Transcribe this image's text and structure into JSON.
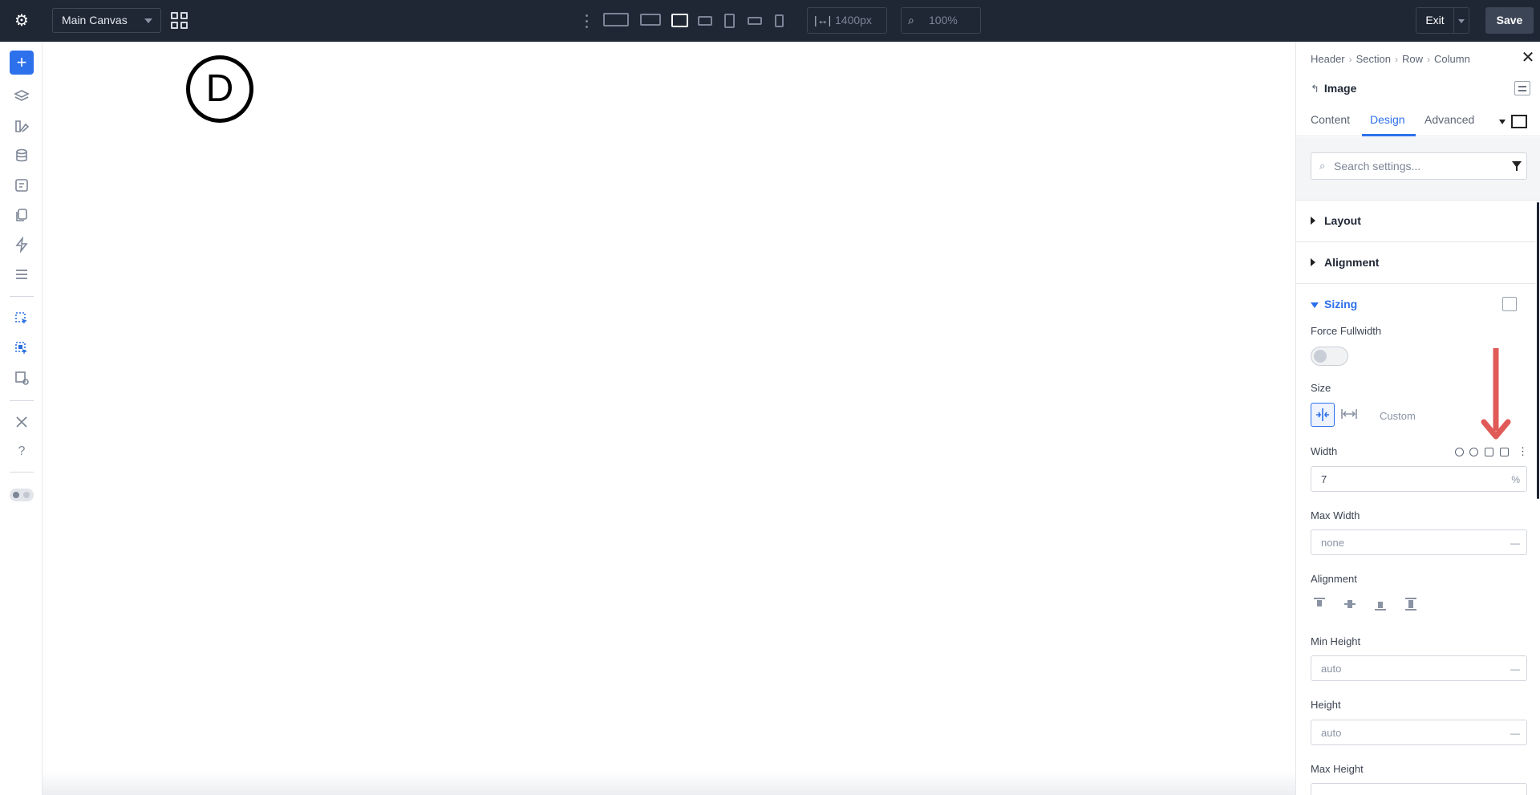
{
  "topbar": {
    "canvas_select": "Main Canvas",
    "width_value": "1400px",
    "zoom_value": "100%",
    "exit_label": "Exit",
    "save_label": "Save"
  },
  "canvas": {
    "logo_letter": "D"
  },
  "panel": {
    "breadcrumb": [
      "Header",
      "Section",
      "Row",
      "Column"
    ],
    "module_title": "Image",
    "tabs": [
      "Content",
      "Design",
      "Advanced"
    ],
    "active_tab": "Design",
    "search_placeholder": "Search settings...",
    "groups": {
      "layout": "Layout",
      "alignment": "Alignment",
      "sizing": "Sizing"
    },
    "sizing": {
      "force_fullwidth_label": "Force Fullwidth",
      "force_fullwidth_on": false,
      "size_label": "Size",
      "size_custom": "Custom",
      "width_label": "Width",
      "width_value": "7",
      "width_unit": "%",
      "max_width_label": "Max Width",
      "max_width_value": "none",
      "max_width_unit": "—",
      "alignment_label": "Alignment",
      "min_height_label": "Min Height",
      "min_height_value": "auto",
      "min_height_unit": "—",
      "height_label": "Height",
      "height_value": "auto",
      "height_unit": "—",
      "max_height_label": "Max Height"
    }
  },
  "colors": {
    "topbar_bg": "#1f2735",
    "accent": "#2d70ec",
    "annotation_arrow": "#e05a57"
  }
}
